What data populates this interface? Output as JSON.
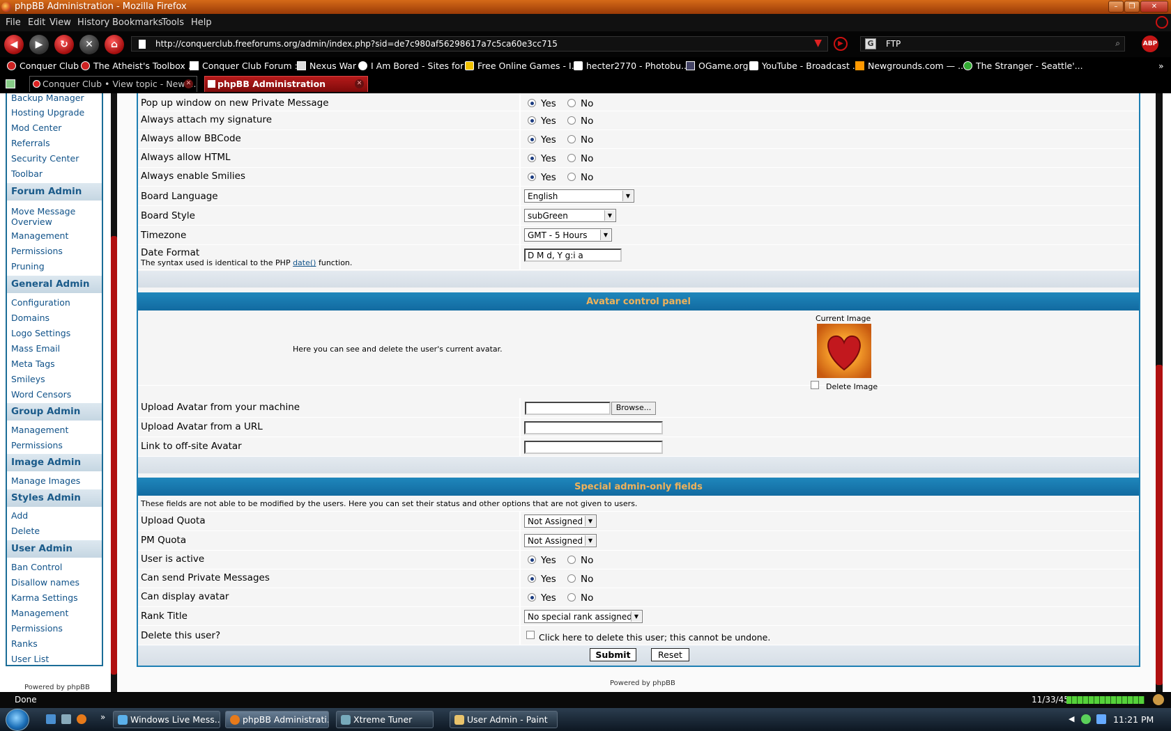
{
  "window": {
    "title": "phpBB Administration - Mozilla Firefox",
    "min": "–",
    "max": "❐",
    "close": "✕"
  },
  "menu": [
    "File",
    "Edit",
    "View",
    "History",
    "Bookmarks",
    "Tools",
    "Help"
  ],
  "nav": {
    "url": "http://conquerclub.freeforums.org/admin/index.php?sid=de7c980af56298617a7c5ca60e3cc715",
    "search_value": "FTP",
    "search_engine": "G",
    "abp": "ABP"
  },
  "bookmarks": [
    "Conquer Club",
    "The Atheist's Toolbox ...",
    "Conquer Club Forum :...",
    "Nexus War",
    "I Am Bored - Sites for ...",
    "Free Online Games - I...",
    "hecter2770 - Photobu...",
    "OGame.org",
    "YouTube - Broadcast ...",
    "Newgrounds.com — ...",
    "The Stranger - Seattle'..."
  ],
  "tabs": [
    {
      "label": "Conquer Club • View topic - New ..."
    },
    {
      "label": "phpBB Administration"
    }
  ],
  "sidebar": {
    "top_links": [
      "Backup Manager",
      "Hosting Upgrade",
      "Mod Center",
      "Referrals",
      "Security Center",
      "Toolbar"
    ],
    "forum_admin": {
      "title": "Forum Admin",
      "links": [
        "Move Message Overview",
        "Management",
        "Permissions",
        "Pruning"
      ]
    },
    "general_admin": {
      "title": "General Admin",
      "links": [
        "Configuration",
        "Domains",
        "Logo Settings",
        "Mass Email",
        "Meta Tags",
        "Smileys",
        "Word Censors"
      ]
    },
    "group_admin": {
      "title": "Group Admin",
      "links": [
        "Management",
        "Permissions"
      ]
    },
    "image_admin": {
      "title": "Image Admin",
      "links": [
        "Manage Images"
      ]
    },
    "styles_admin": {
      "title": "Styles Admin",
      "links": [
        "Add",
        "Delete"
      ]
    },
    "user_admin": {
      "title": "User Admin",
      "links": [
        "Ban Control",
        "Disallow names",
        "Karma Settings",
        "Management",
        "Permissions",
        "Ranks",
        "User List"
      ]
    },
    "powered": "Powered by phpBB"
  },
  "form": {
    "yes": "Yes",
    "no": "No",
    "prefs": [
      {
        "label": "Pop up window on new Private Message",
        "value": "Yes"
      },
      {
        "label": "Always attach my signature",
        "value": "Yes"
      },
      {
        "label": "Always allow BBCode",
        "value": "Yes"
      },
      {
        "label": "Always allow HTML",
        "value": "Yes"
      },
      {
        "label": "Always enable Smilies",
        "value": "Yes"
      }
    ],
    "board_language": {
      "label": "Board Language",
      "value": "English"
    },
    "board_style": {
      "label": "Board Style",
      "value": "subGreen"
    },
    "timezone": {
      "label": "Timezone",
      "value": "GMT - 5 Hours"
    },
    "date_format": {
      "label": "Date Format",
      "help_pre": "The syntax used is identical to the PHP",
      "help_link": "date()",
      "help_post": "function.",
      "value": "D M d, Y g:i a"
    },
    "avatar": {
      "header": "Avatar control panel",
      "explain": "Here you can see and delete the user's current avatar.",
      "current_image": "Current Image",
      "delete_image": "Delete Image",
      "upload_machine": "Upload Avatar from your machine",
      "browse": "Browse...",
      "upload_url": "Upload Avatar from a URL",
      "offsite": "Link to off-site Avatar"
    },
    "special": {
      "header": "Special admin-only fields",
      "explain": "These fields are not able to be modified by the users. Here you can set their status and other options that are not given to users.",
      "upload_quota": {
        "label": "Upload Quota",
        "value": "Not Assigned"
      },
      "pm_quota": {
        "label": "PM Quota",
        "value": "Not Assigned"
      },
      "active": {
        "label": "User is active",
        "value": "Yes"
      },
      "can_pm": {
        "label": "Can send Private Messages",
        "value": "Yes"
      },
      "can_avatar": {
        "label": "Can display avatar",
        "value": "Yes"
      },
      "rank": {
        "label": "Rank Title",
        "value": "No special rank assigned"
      },
      "delete": {
        "label": "Delete this user?",
        "checkbox_text": "Click here to delete this user; this cannot be undone."
      }
    },
    "submit": "Submit",
    "reset": "Reset"
  },
  "main_powered": "Powered by phpBB",
  "status": {
    "text": "Done",
    "counter": "11/33/45"
  },
  "taskbar": {
    "items": [
      "Windows Live Mess...",
      "phpBB Administrati...",
      "Xtreme Tuner",
      "User Admin - Paint"
    ],
    "time": "11:21 PM"
  }
}
